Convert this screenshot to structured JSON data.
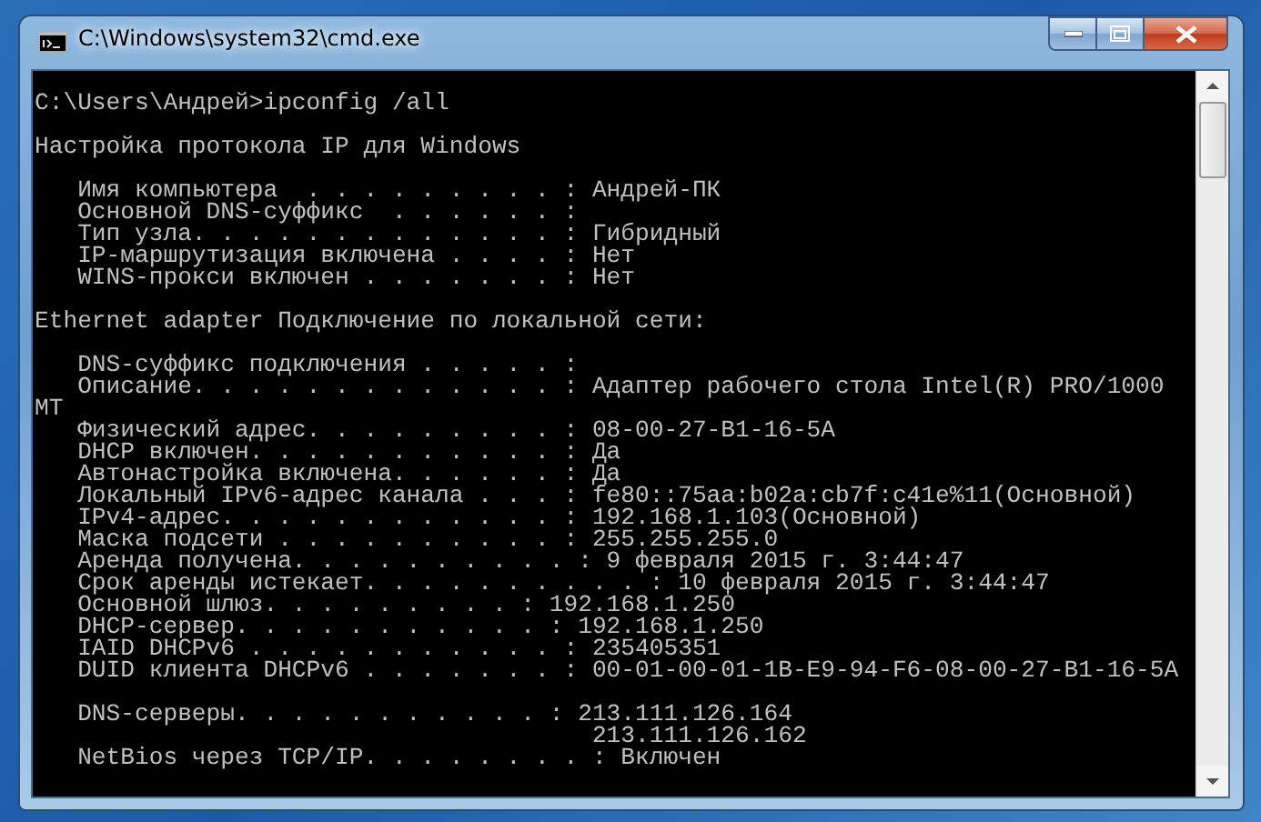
{
  "window": {
    "title": "C:\\Windows\\system32\\cmd.exe"
  },
  "console": {
    "blocks": [
      [
        "C:\\Users\\Андрей>ipconfig /all"
      ],
      [
        "Настройка протокола IP для Windows"
      ],
      [
        "   Имя компьютера  . . . . . . . . . : Андрей-ПК",
        "   Основной DNS-суффикс  . . . . . . :",
        "   Тип узла. . . . . . . . . . . . . : Гибридный",
        "   IP-маршрутизация включена . . . . : Нет",
        "   WINS-прокси включен . . . . . . . : Нет"
      ],
      [
        "Ethernet adapter Подключение по локальной сети:"
      ],
      [
        "   DNS-суффикс подключения . . . . . :",
        "   Описание. . . . . . . . . . . . . : Адаптер рабочего стола Intel(R) PRO/1000",
        "MT",
        "   Физический адрес. . . . . . . . . : 08-00-27-B1-16-5A",
        "   DHCP включен. . . . . . . . . . . : Да",
        "   Автонастройка включена. . . . . . : Да",
        "   Локальный IPv6-адрес канала . . . : fe80::75aa:b02a:cb7f:c41e%11(Основной)",
        "   IPv4-адрес. . . . . . . . . . . . : 192.168.1.103(Основной)",
        "   Маска подсети . . . . . . . . . . : 255.255.255.0",
        "   Аренда получена. . . . . . . . . . : 9 февраля 2015 г. 3:44:47",
        "   Срок аренды истекает. . . . . . . . . . : 10 февраля 2015 г. 3:44:47",
        "   Основной шлюз. . . . . . . . . : 192.168.1.250",
        "   DHCP-сервер. . . . . . . . . . . : 192.168.1.250",
        "   IAID DHCPv6 . . . . . . . . . . . : 235405351",
        "   DUID клиента DHCPv6 . . . . . . . : 00-01-00-01-1B-E9-94-F6-08-00-27-B1-16-5A"
      ],
      [
        "   DNS-серверы. . . . . . . . . . . : 213.111.126.164",
        "                                       213.111.126.162",
        "   NetBios через TCP/IP. . . . . . . . : Включен"
      ]
    ]
  }
}
